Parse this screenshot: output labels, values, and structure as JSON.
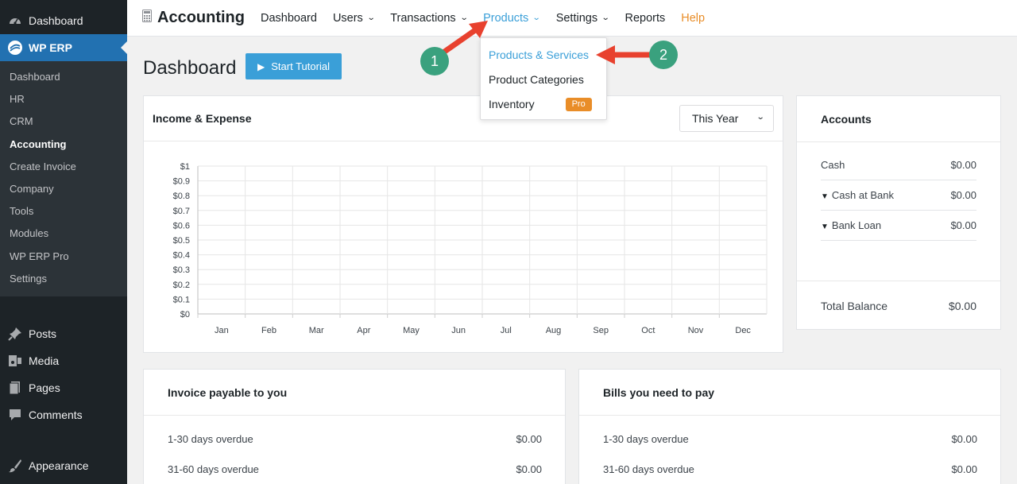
{
  "sidebar": {
    "top": [
      {
        "label": "Dashboard",
        "icon": "dashboard-icon"
      },
      {
        "label": "WP ERP",
        "icon": "wperp-icon"
      }
    ],
    "submenu": [
      "Dashboard",
      "HR",
      "CRM",
      "Accounting",
      "Create Invoice",
      "Company",
      "Tools",
      "Modules",
      "WP ERP Pro",
      "Settings"
    ],
    "current_sub": "Accounting",
    "bottom": [
      {
        "label": "Posts",
        "icon": "pin-icon"
      },
      {
        "label": "Media",
        "icon": "media-icon"
      },
      {
        "label": "Pages",
        "icon": "pages-icon"
      },
      {
        "label": "Comments",
        "icon": "comments-icon"
      },
      {
        "label": "Appearance",
        "icon": "brush-icon"
      }
    ]
  },
  "topnav": {
    "brand": "Accounting",
    "items": [
      {
        "label": "Dashboard",
        "has_menu": false
      },
      {
        "label": "Users",
        "has_menu": true
      },
      {
        "label": "Transactions",
        "has_menu": true
      },
      {
        "label": "Products",
        "has_menu": true
      },
      {
        "label": "Settings",
        "has_menu": true
      },
      {
        "label": "Reports",
        "has_menu": false
      },
      {
        "label": "Help",
        "has_menu": false
      }
    ],
    "active": "Products"
  },
  "dropdown": {
    "items": [
      "Products & Services",
      "Product Categories",
      "Inventory"
    ],
    "pro_badge": "Pro"
  },
  "page": {
    "title": "Dashboard",
    "tutorial_button": "Start Tutorial"
  },
  "income": {
    "title": "Income & Expense",
    "period": "This Year"
  },
  "chart_data": {
    "type": "line",
    "title": "Income & Expense",
    "categories": [
      "Jan",
      "Feb",
      "Mar",
      "Apr",
      "May",
      "Jun",
      "Jul",
      "Aug",
      "Sep",
      "Oct",
      "Nov",
      "Dec"
    ],
    "yticks": [
      "$0",
      "$0.1",
      "$0.2",
      "$0.3",
      "$0.4",
      "$0.5",
      "$0.6",
      "$0.7",
      "$0.8",
      "$0.9",
      "$1"
    ],
    "ylim": [
      0,
      1
    ],
    "series": [],
    "grid": true
  },
  "accounts": {
    "title": "Accounts",
    "rows": [
      {
        "label": "Cash",
        "value": "$0.00",
        "expandable": false
      },
      {
        "label": "Cash at Bank",
        "value": "$0.00",
        "expandable": true
      },
      {
        "label": "Bank Loan",
        "value": "$0.00",
        "expandable": true
      }
    ],
    "total_label": "Total Balance",
    "total_value": "$0.00"
  },
  "invoice": {
    "title": "Invoice payable to you",
    "rows": [
      {
        "label": "1-30 days overdue",
        "value": "$0.00"
      },
      {
        "label": "31-60 days overdue",
        "value": "$0.00"
      }
    ]
  },
  "bills": {
    "title": "Bills you need to pay",
    "rows": [
      {
        "label": "1-30 days overdue",
        "value": "$0.00"
      },
      {
        "label": "31-60 days overdue",
        "value": "$0.00"
      }
    ]
  },
  "annotations": [
    "1",
    "2"
  ],
  "colors": {
    "accent": "#3a9fd8",
    "help": "#e98d28",
    "badge": "#3aa17e",
    "arrow": "#e8412e",
    "sidebar": "#1d2327",
    "wp_blue": "#2271b1"
  }
}
